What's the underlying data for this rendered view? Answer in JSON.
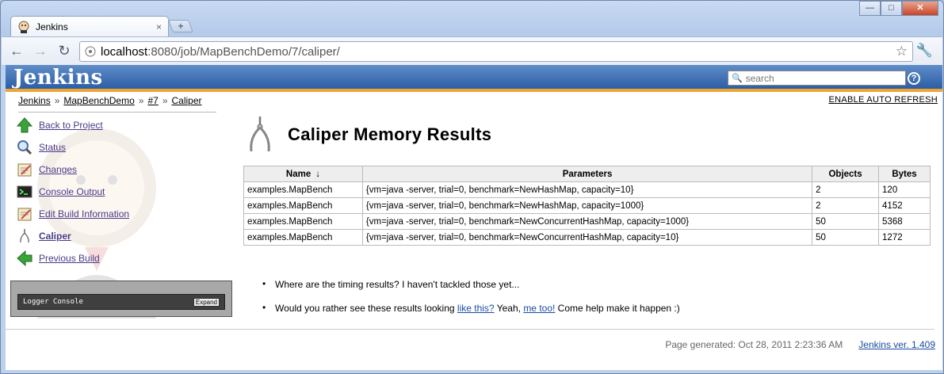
{
  "browser": {
    "tab_title": "Jenkins",
    "tab_close": "×",
    "new_tab": "+",
    "url_host": "localhost",
    "url_path": ":8080/job/MapBenchDemo/7/caliper/",
    "win_minimize": "—",
    "win_maximize": "□",
    "win_close": "✕"
  },
  "header": {
    "logo": "Jenkins",
    "search_placeholder": "search",
    "help": "?"
  },
  "breadcrumb": {
    "items": [
      "Jenkins",
      "MapBenchDemo",
      "#7",
      "Caliper"
    ],
    "separator": "»"
  },
  "auto_refresh": "ENABLE AUTO REFRESH",
  "sidebar": {
    "items": [
      {
        "label": "Back to Project",
        "icon": "up-arrow-icon"
      },
      {
        "label": "Status",
        "icon": "magnifier-icon"
      },
      {
        "label": "Changes",
        "icon": "notepad-icon"
      },
      {
        "label": "Console Output",
        "icon": "terminal-icon"
      },
      {
        "label": "Edit Build Information",
        "icon": "notepad-edit-icon"
      },
      {
        "label": "Caliper",
        "icon": "caliper-icon"
      },
      {
        "label": "Previous Build",
        "icon": "left-arrow-icon"
      }
    ],
    "logger_title": "Logger Console",
    "logger_expand": "Expand"
  },
  "main": {
    "title": "Caliper Memory Results",
    "table": {
      "headers": [
        "Name",
        "Parameters",
        "Objects",
        "Bytes"
      ],
      "sort_indicator": "↓",
      "rows": [
        [
          "examples.MapBench",
          "{vm=java -server, trial=0, benchmark=NewHashMap, capacity=10}",
          "2",
          "120"
        ],
        [
          "examples.MapBench",
          "{vm=java -server, trial=0, benchmark=NewHashMap, capacity=1000}",
          "2",
          "4152"
        ],
        [
          "examples.MapBench",
          "{vm=java -server, trial=0, benchmark=NewConcurrentHashMap, capacity=1000}",
          "50",
          "5368"
        ],
        [
          "examples.MapBench",
          "{vm=java -server, trial=0, benchmark=NewConcurrentHashMap, capacity=10}",
          "50",
          "1272"
        ]
      ]
    },
    "notes": {
      "line1": "Where are the timing results? I haven't tackled those yet...",
      "line2_pre": "Would you rather see these results looking ",
      "line2_link1": "like this?",
      "line2_mid": " Yeah, ",
      "line2_link2": "me too!",
      "line2_post": " Come help make it happen :)"
    }
  },
  "footer": {
    "generated": "Page generated: Oct 28, 2011 2:23:36 AM",
    "version": "Jenkins ver. 1.409"
  }
}
